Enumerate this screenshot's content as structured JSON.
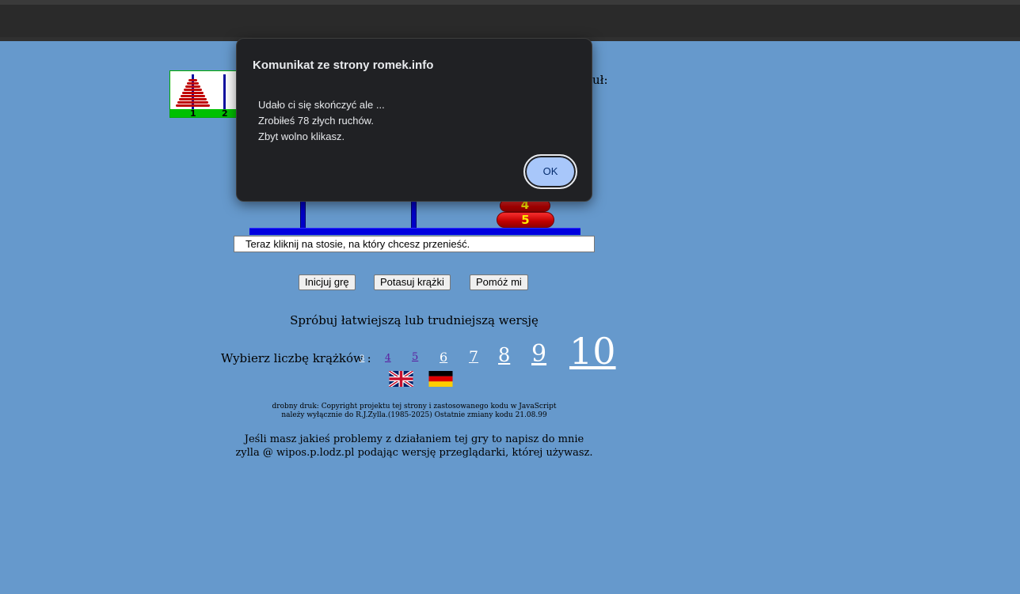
{
  "dialog": {
    "title": "Komunikat ze strony romek.info",
    "line1": "Udało ci się skończyć ale ...",
    "line2": "Zrobiłeś  78 złych ruchów.",
    "line3": "Zbyt wolno klikasz.",
    "ok_label": "OK"
  },
  "thumbnail": {
    "peg1_label": "1",
    "peg2_label": "2"
  },
  "partial_text": "uł:",
  "board": {
    "disk4_label": "4",
    "disk5_label": "5"
  },
  "status_text": "Teraz kliknij na stosie, na który chcesz przenieść.",
  "buttons": {
    "init": "Inicjuj grę",
    "shuffle": "Potasuj krążki",
    "help": "Pomóż mi"
  },
  "try_text": "Spróbuj łatwiejszą lub trudniejszą wersję",
  "choose_label": "Wybierz liczbę krążków :",
  "disk_counts": [
    "3",
    "4",
    "5",
    "6",
    "7",
    "8",
    "9",
    "10"
  ],
  "flags": [
    "uk-flag",
    "german-flag"
  ],
  "fine_print": {
    "line1": "drobny druk: Copyright projektu tej strony i zastosowanego kodu w JavaScript",
    "line2": "należy wyłącznie do R.J.Zylla.(1985-2025) Ostatnie zmiany kodu 21.08.99"
  },
  "contact": {
    "line1": "Jeśli masz jakieś problemy z działaniem tej gry to napisz do mnie",
    "line2": "zylla @ wipos.p.lodz.pl podając wersję przeglądarki, której używasz."
  },
  "colors": {
    "background": "#6699cc",
    "dialog_bg": "#202124",
    "ok_button": "#a8c7fa",
    "disk": "#cc0000"
  }
}
